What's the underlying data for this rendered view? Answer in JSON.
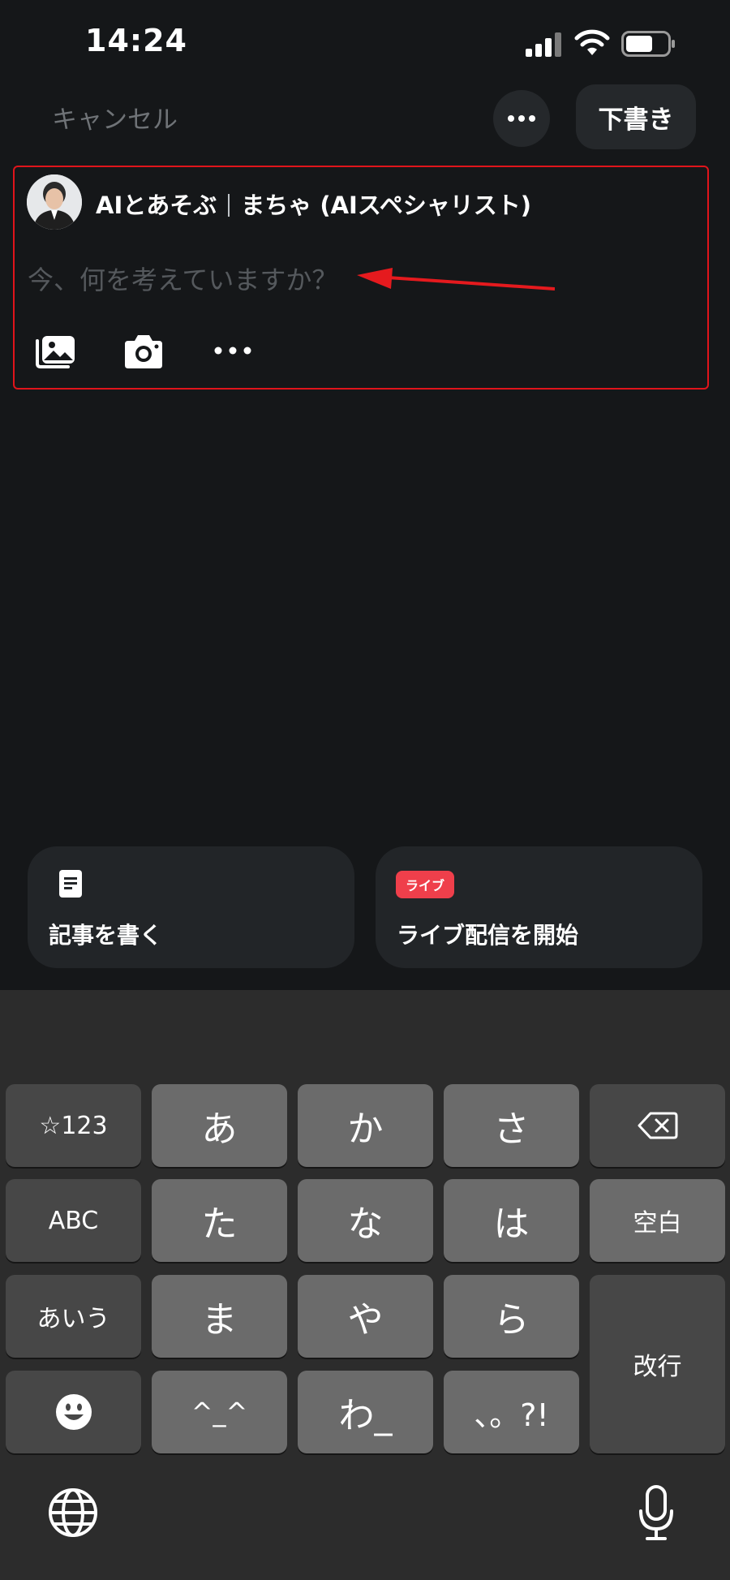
{
  "status_bar": {
    "time": "14:24"
  },
  "nav": {
    "cancel_label": "キャンセル",
    "draft_label": "下書き"
  },
  "compose": {
    "user_name_part1": "AIとあそぶ",
    "user_name_part2": "まちゃ (AIスペシャリスト)",
    "placeholder": "今、何を考えていますか？"
  },
  "cards": {
    "article_label": "記事を書く",
    "live_badge": "ライブ",
    "live_label": "ライブ配信を開始"
  },
  "keyboard": {
    "rows": [
      [
        "☆123",
        "あ",
        "か",
        "さ",
        "delete"
      ],
      [
        "ABC",
        "た",
        "な",
        "は",
        "空白"
      ],
      [
        "あいう",
        "ま",
        "や",
        "ら",
        "改行"
      ],
      [
        "emoji",
        "^_^",
        "わ_",
        "、。?!"
      ]
    ],
    "k_123": "☆123",
    "k_a": "あ",
    "k_ka": "か",
    "k_sa": "さ",
    "k_abc": "ABC",
    "k_ta": "た",
    "k_na": "な",
    "k_ha": "は",
    "k_space": "空白",
    "k_aiu": "あいう",
    "k_ma": "ま",
    "k_ya": "や",
    "k_ra": "ら",
    "k_return": "改行",
    "k_kaomoji": "^_^",
    "k_wa": "わ_",
    "k_punct": "、。?!"
  },
  "colors": {
    "background": "#151719",
    "highlight_border": "#e0141b",
    "live_badge": "#ef3f4b",
    "keyboard_bg": "#2c2c2c"
  }
}
